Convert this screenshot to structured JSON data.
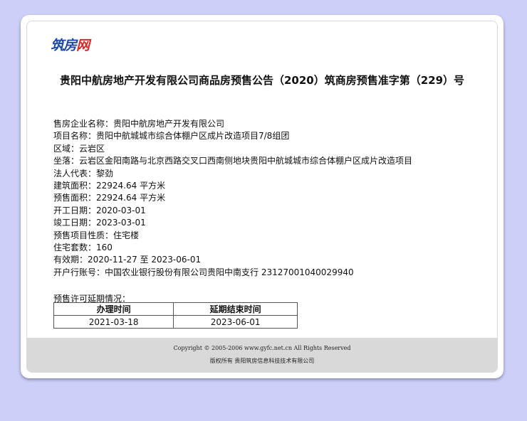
{
  "logo": {
    "main": "筑房",
    "accent": "网"
  },
  "title": "贵阳中航房地产开发有限公司商品房预售公告（2020）筑商房预售准字第（229）号",
  "info_rows": [
    "售房企业名称：贵阳中航房地产开发有限公司",
    "项目名称：贵阳中航城城市综合体棚户区成片改造项目7/8组团",
    "区域：云岩区",
    "坐落：云岩区金阳南路与北京西路交叉口西南侧地块贵阳中航城城市综合体棚户区成片改造项目",
    "法人代表：黎劲",
    "建筑面积：22924.64 平方米",
    "预售面积：22924.64 平方米",
    "开工日期：2020-03-01",
    "竣工日期：2023-03-01",
    "预售项目性质：住宅楼",
    "住宅套数：160",
    "有效期：2020-11-27 至 2023-06-01",
    "开户行账号：中国农业银行股份有限公司贵阳中南支行 23127001040029940"
  ],
  "extension": {
    "label": "预售许可延期情况：",
    "headers": [
      "办理时间",
      "延期结束时间"
    ],
    "rows": [
      [
        "2021-03-18",
        "2023-06-01"
      ]
    ]
  },
  "footer": {
    "copyright": "Copyright © 2005-2006 www.gyfc.net.cn All Rights Reserved",
    "owner": "版权所有 贵阳筑房信息科技技术有限公司"
  },
  "colors": {
    "background": "#cccff7",
    "logo": "#1e4aa6",
    "logo_accent": "#d62a2a",
    "footer": "#d9d9d9"
  }
}
